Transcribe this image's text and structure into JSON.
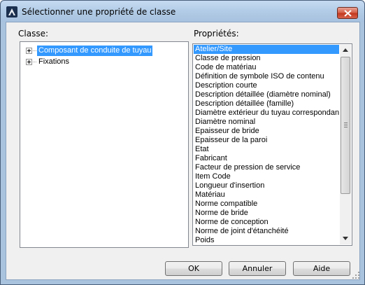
{
  "window": {
    "title": "Sélectionner une propriété de classe"
  },
  "classe": {
    "label": "Classe:",
    "items": [
      {
        "label": "Composant de conduite de tuyau",
        "selected": true
      },
      {
        "label": "Fixations",
        "selected": false
      }
    ]
  },
  "proprietes": {
    "label": "Propriétés:",
    "items": [
      {
        "label": "Atelier/Site",
        "selected": true
      },
      {
        "label": "Classe de pression"
      },
      {
        "label": "Code de matériau"
      },
      {
        "label": "Définition de symbole ISO de contenu"
      },
      {
        "label": "Description courte"
      },
      {
        "label": "Description détaillée (diamètre nominal)"
      },
      {
        "label": "Description détaillée (famille)"
      },
      {
        "label": "Diamètre extérieur du tuyau correspondant"
      },
      {
        "label": "Diamètre nominal"
      },
      {
        "label": "Epaisseur de bride"
      },
      {
        "label": "Epaisseur de la paroi"
      },
      {
        "label": "Etat"
      },
      {
        "label": "Fabricant"
      },
      {
        "label": "Facteur de pression de service"
      },
      {
        "label": "Item Code"
      },
      {
        "label": "Longueur d'insertion"
      },
      {
        "label": "Matériau"
      },
      {
        "label": "Norme compatible"
      },
      {
        "label": "Norme de bride"
      },
      {
        "label": "Norme de conception"
      },
      {
        "label": "Norme de joint d'étanchéité"
      },
      {
        "label": "Poids"
      }
    ]
  },
  "buttons": {
    "ok": "OK",
    "annuler": "Annuler",
    "aide": "Aide"
  },
  "icons": {
    "app": "autocad-icon",
    "close": "close-icon",
    "scroll_up": "chevron-up-icon",
    "scroll_down": "chevron-down-icon",
    "expand": "plus-expander-icon",
    "resize": "resize-grip-icon"
  },
  "colors": {
    "selection": "#3399ff",
    "close_button": "#c2391f",
    "titlebar": "#b2cbe6"
  }
}
